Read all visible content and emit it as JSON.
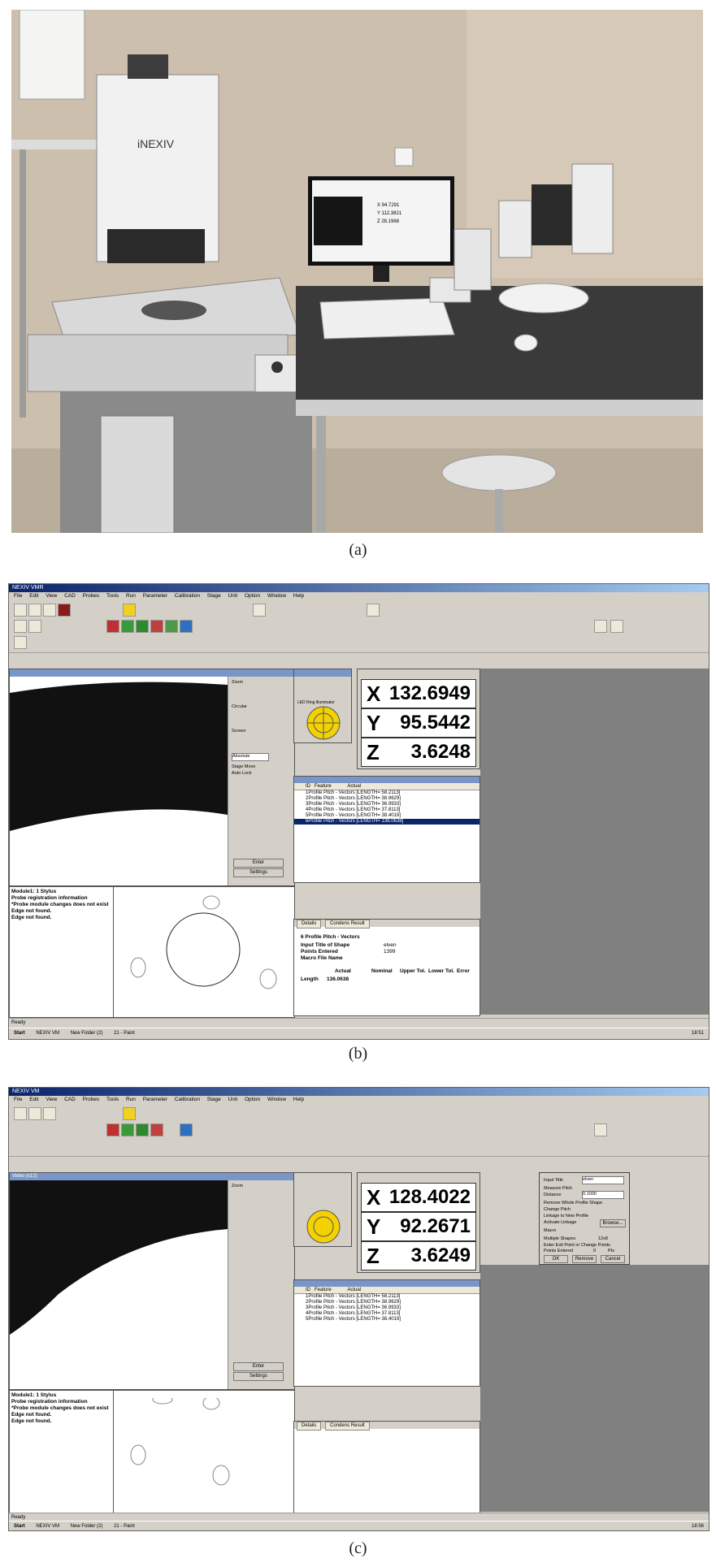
{
  "captions": {
    "a": "(a)",
    "b": "(b)",
    "c": "(c)"
  },
  "photo": {
    "brand_label": "iNEXIV",
    "monitor_x": "X 94.7291",
    "monitor_y": "Y 112.3821",
    "monitor_z": "Z 28.1968"
  },
  "screen_b": {
    "title": "NEXIV VMR",
    "menu": [
      "File",
      "Edit",
      "View",
      "CAD",
      "Probes",
      "Tools",
      "Run",
      "Parameter",
      "Calibration",
      "Stage",
      "Unit",
      "Option",
      "Window",
      "Help"
    ],
    "dro": {
      "x_label": "X",
      "x_value": "132.6949",
      "y_label": "Y",
      "y_value": "95.5442",
      "z_label": "Z",
      "z_value": "3.6248"
    },
    "list_header": {
      "id": "ID",
      "feature": "Feature",
      "actual": "Actual"
    },
    "list_rows": [
      "1Profile Pitch - Vectors [LENGTH=   58.2113]",
      "2Profile Pitch - Vectors [LENGTH=   38.9629]",
      "3Profile Pitch - Vectors [LENGTH=   36.9933]",
      "4Profile Pitch - Vectors [LENGTH=   37.8113]",
      "5Profile Pitch - Vectors [LENGTH=   38.4019]",
      "6Profile Pitch - Vectors [LENGTH=  136.0638]"
    ],
    "messages": [
      "Module1: 1 Stylus",
      "Probe registration information",
      "*Probe module changes does not exist",
      "Edge not found.",
      "Edge not found."
    ],
    "tabs": [
      "Details",
      "Condens Result"
    ],
    "details": {
      "line1": "6    Profile Pitch - Vectors",
      "line2_label": "Input Title of Shape",
      "line2_value": "elven",
      "line3_label": "Points Entered",
      "line3_value": "1399",
      "line4_label": "Macro File Name",
      "col_actual": "Actual",
      "col_nominal": "Nominal",
      "col_upper": "Upper Tol.",
      "col_lower": "Lower Tol.",
      "col_error": "Error",
      "col_judg": "Judg",
      "row_label": "Length",
      "row_value": "136.0638"
    },
    "panel_labels": {
      "zoom": "Zoom",
      "circular": "Circular",
      "screen": "Screen",
      "absolute": "Absolute",
      "enter": "Enter",
      "settings": "Settings",
      "stage_move": "Stage Move",
      "auto_lock": "Auto Lock",
      "led": "LED Ring Illuminator",
      "reset": "Reset"
    },
    "status_left": "Ready",
    "taskbar": {
      "start": "Start",
      "app": "NEXIV VM",
      "folder": "New Folder (2)",
      "paint": "21 - Paint",
      "clock": "18:51"
    }
  },
  "screen_c": {
    "title": "NEXIV VM",
    "dro": {
      "x_label": "X",
      "x_value": "128.4022",
      "y_label": "Y",
      "y_value": "92.2671",
      "z_label": "Z",
      "z_value": "3.6249"
    },
    "list_rows": [
      "1Profile Pitch - Vectors [LENGTH=   58.2113]",
      "2Profile Pitch - Vectors [LENGTH=   38.9629]",
      "3Profile Pitch - Vectors [LENGTH=   36.9933]",
      "4Profile Pitch - Vectors [LENGTH=   37.8113]",
      "5Profile Pitch - Vectors [LENGTH=   38.4019]"
    ],
    "video_title": "Video (x12)",
    "dialog": {
      "input_title": "Input Title",
      "input_value": "elven",
      "measure_pitch": "Measure Pitch",
      "distance": "Distance",
      "distance_value": "0.1000",
      "remove_whole": "Remove Whole Profile Shape",
      "change_pitch": "Change Pitch",
      "linkage": "Linkage to New Profile",
      "activate_linkage": "Activate Linkage",
      "browse": "Browse...",
      "macro": "Macro",
      "multiple": "Multiple Shapes",
      "12x8": "12x8",
      "enter_exit": "Enter Exit Point or Change Points",
      "points_entered": "Points Entered",
      "points_value": "0",
      "pts": "Pts",
      "ok": "OK",
      "remove": "Remove",
      "cancel": "Cancel"
    },
    "taskbar": {
      "start": "Start",
      "app": "NEXIV VM",
      "folder": "New Folder (2)",
      "paint": "21 - Paint",
      "clock": "18:56"
    }
  }
}
